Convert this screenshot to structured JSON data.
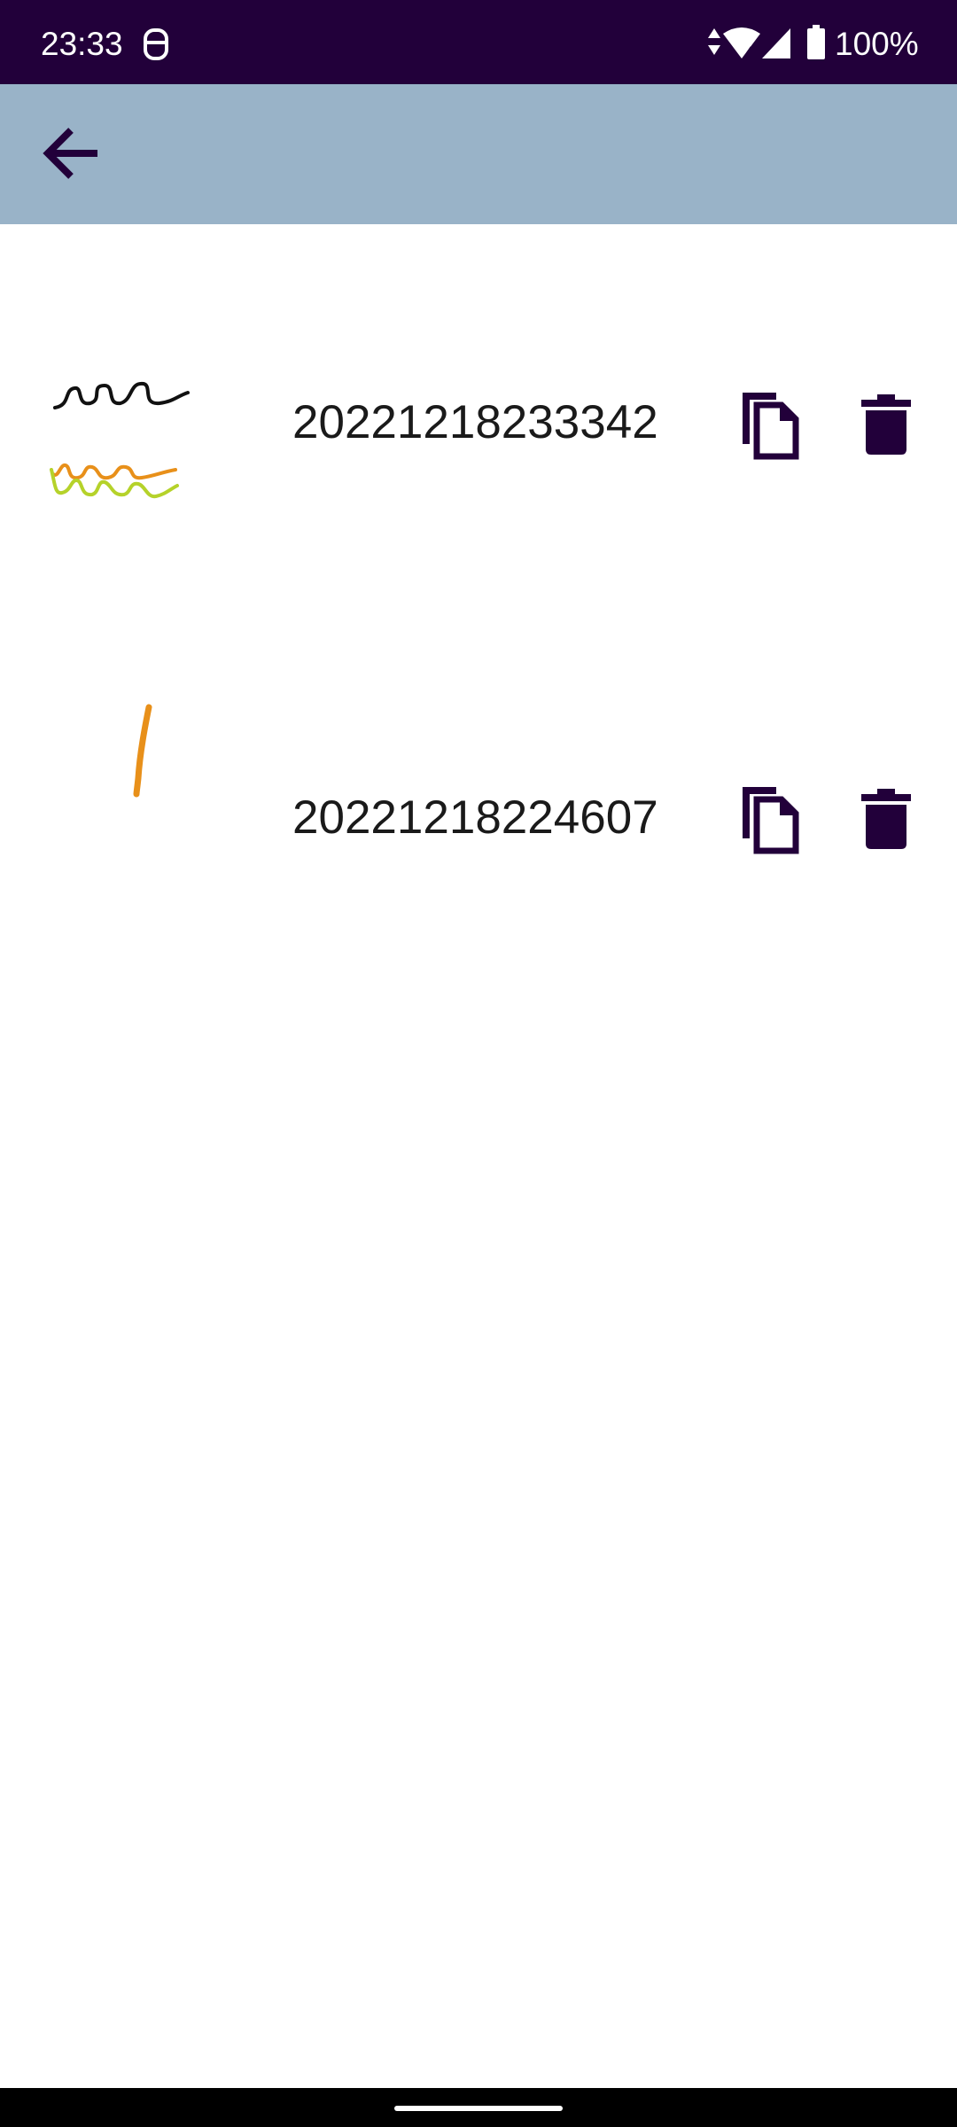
{
  "status_bar": {
    "time": "23:33",
    "battery": "100%",
    "icons": [
      "notification-icon",
      "data-arrows-icon",
      "wifi-icon",
      "signal-icon",
      "battery-icon"
    ]
  },
  "app_bar": {
    "back_icon": "arrow-back-icon"
  },
  "drawings": [
    {
      "title": "20221218233342",
      "stroke_colors": [
        "#111111",
        "#e8901a",
        "#b5d22a"
      ]
    },
    {
      "title": "20221218224607",
      "stroke_colors": [
        "#e8901a"
      ]
    }
  ],
  "actions": {
    "copy_icon": "copy-icon",
    "delete_icon": "delete-icon"
  },
  "colors": {
    "status_bar": "#22003a",
    "app_bar": "#99b3c8",
    "icon_tint": "#22003a"
  }
}
